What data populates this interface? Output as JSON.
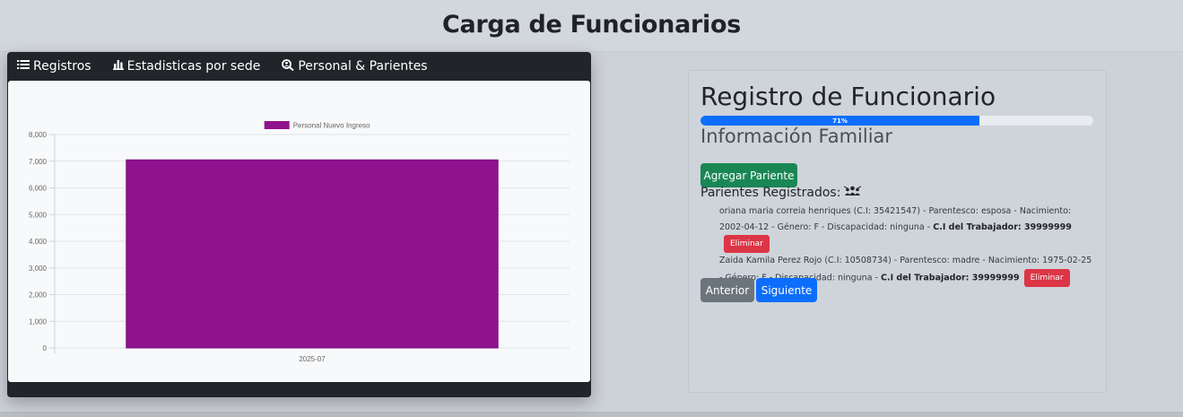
{
  "header": {
    "title": "Carga de Funcionarios"
  },
  "tabs": [
    {
      "label": "Registros",
      "icon": "list-icon"
    },
    {
      "label": "Estadisticas por sede",
      "icon": "bar-chart-icon"
    },
    {
      "label": "Personal & Parientes",
      "icon": "search-people-icon"
    }
  ],
  "chart_data": {
    "type": "bar",
    "title": "",
    "categories": [
      "2025-07"
    ],
    "series": [
      {
        "name": "Personal Nuevo Ingreso",
        "values": [
          7050
        ],
        "color": "#8f128f"
      }
    ],
    "ylim": [
      0,
      8000
    ],
    "yticks": [
      "8,000",
      "7,000",
      "6,000",
      "5,000",
      "4,000",
      "3,000",
      "2,000",
      "1,000",
      "0"
    ],
    "legend": "top",
    "grid": true
  },
  "form": {
    "title": "Registro de Funcionario",
    "progress": 0.71,
    "progress_label": "71%",
    "section_title": "Información Familiar",
    "add_button": "Agregar Pariente",
    "relatives_title": "Parientes Registrados:",
    "relatives": [
      {
        "text": "oriana maria correia henriques (C.I: 35421547) - Parentesco: esposa - Nacimiento: 2002-04-12 - Género: F - Discapacidad: ninguna - ",
        "worker_label": "C.I del Trabajador: 39999999",
        "delete_label": "Eliminar"
      },
      {
        "text": "Zaida Kamila Perez Rojo (C.I: 10508734) - Parentesco: madre - Nacimiento: 1975-02-25 - Género: F - Discapacidad: ninguna - ",
        "worker_label": "C.I del Trabajador: 39999999",
        "delete_label": "Eliminar"
      }
    ],
    "prev_button": "Anterior",
    "next_button": "Siguiente"
  },
  "colors": {
    "primary": "#0d6efd",
    "success": "#198754",
    "secondary": "#6c757d",
    "danger": "#dc3545",
    "dark": "#212529",
    "bar": "#8f128f"
  }
}
